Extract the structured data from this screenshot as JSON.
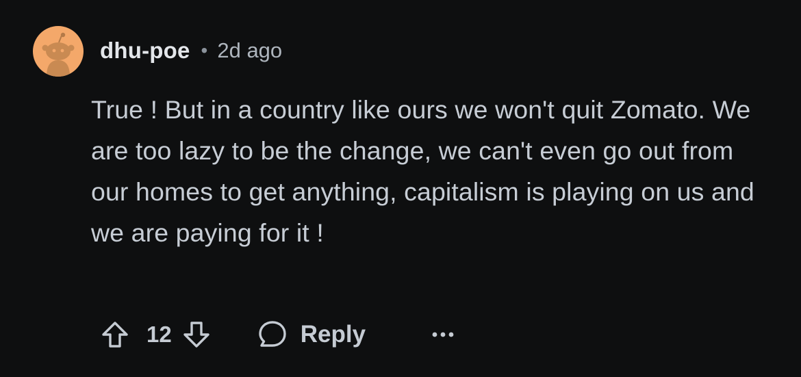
{
  "comment": {
    "username": "dhu-poe",
    "separator": "•",
    "timestamp": "2d ago",
    "text": "True ! But in a country like ours we won't quit Zomato. We are too lazy to be the change, we can't even go out from our homes to get anything, capitalism is playing on us and we are paying for it !",
    "avatar_color": "#f4a86a"
  },
  "actions": {
    "upvote_icon": "upvote-arrow-icon",
    "vote_count": "12",
    "downvote_icon": "downvote-arrow-icon",
    "reply_icon": "speech-bubble-icon",
    "reply_label": "Reply",
    "more_icon": "ellipsis-icon"
  }
}
